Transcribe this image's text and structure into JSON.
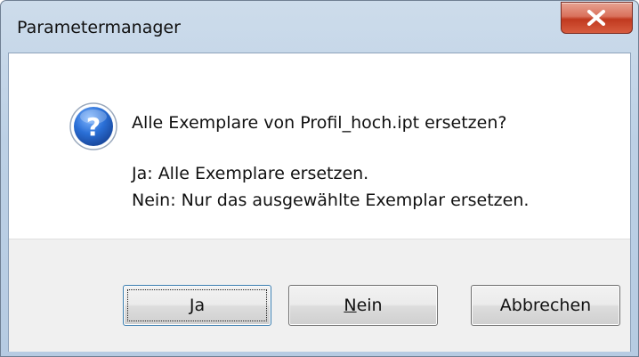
{
  "window": {
    "title": "Parametermanager",
    "close_label": "X"
  },
  "message": {
    "question": "Alle Exemplare von Profil_hoch.ipt ersetzen?",
    "line_yes": "Ja: Alle Exemplare ersetzen.",
    "line_no": "Nein: Nur das ausgewählte Exemplar ersetzen.",
    "icon": "question-icon"
  },
  "buttons": {
    "yes": {
      "mnemonic": "J",
      "rest": "a"
    },
    "no": {
      "mnemonic": "N",
      "rest": "ein"
    },
    "cancel": {
      "label": "Abbrechen"
    }
  },
  "colors": {
    "close": "#c0391f",
    "icon": "#1f5fbf"
  }
}
